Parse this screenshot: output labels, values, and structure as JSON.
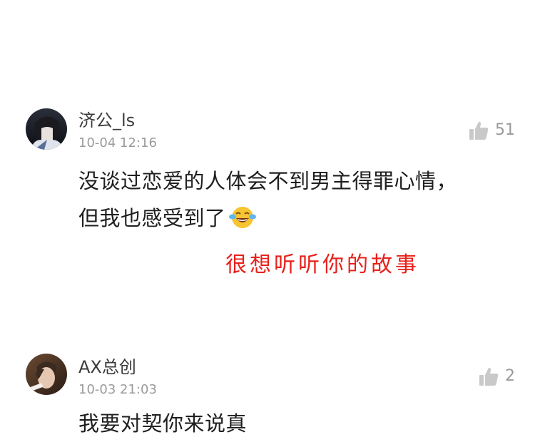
{
  "comments": [
    {
      "username": "济公_ls",
      "time": "10-04 12:16",
      "likes": "51",
      "text_line1": "没谈过恋爱的人体会不到男主得罪心情，",
      "text_line2": "但我也感受到了",
      "emoji": "laughing-crying-emoji"
    },
    {
      "username": "AX总创",
      "time": "10-03 21:03",
      "likes": "2",
      "text_partial": "我要对契你来说真"
    }
  ],
  "annotation": {
    "text": "很想听听你的故事",
    "color": "#e8201a"
  },
  "colors": {
    "username": "#3b3b3b",
    "meta": "#9a9a9a",
    "body": "#1f1f1f",
    "like_icon": "#c9c9c9"
  }
}
